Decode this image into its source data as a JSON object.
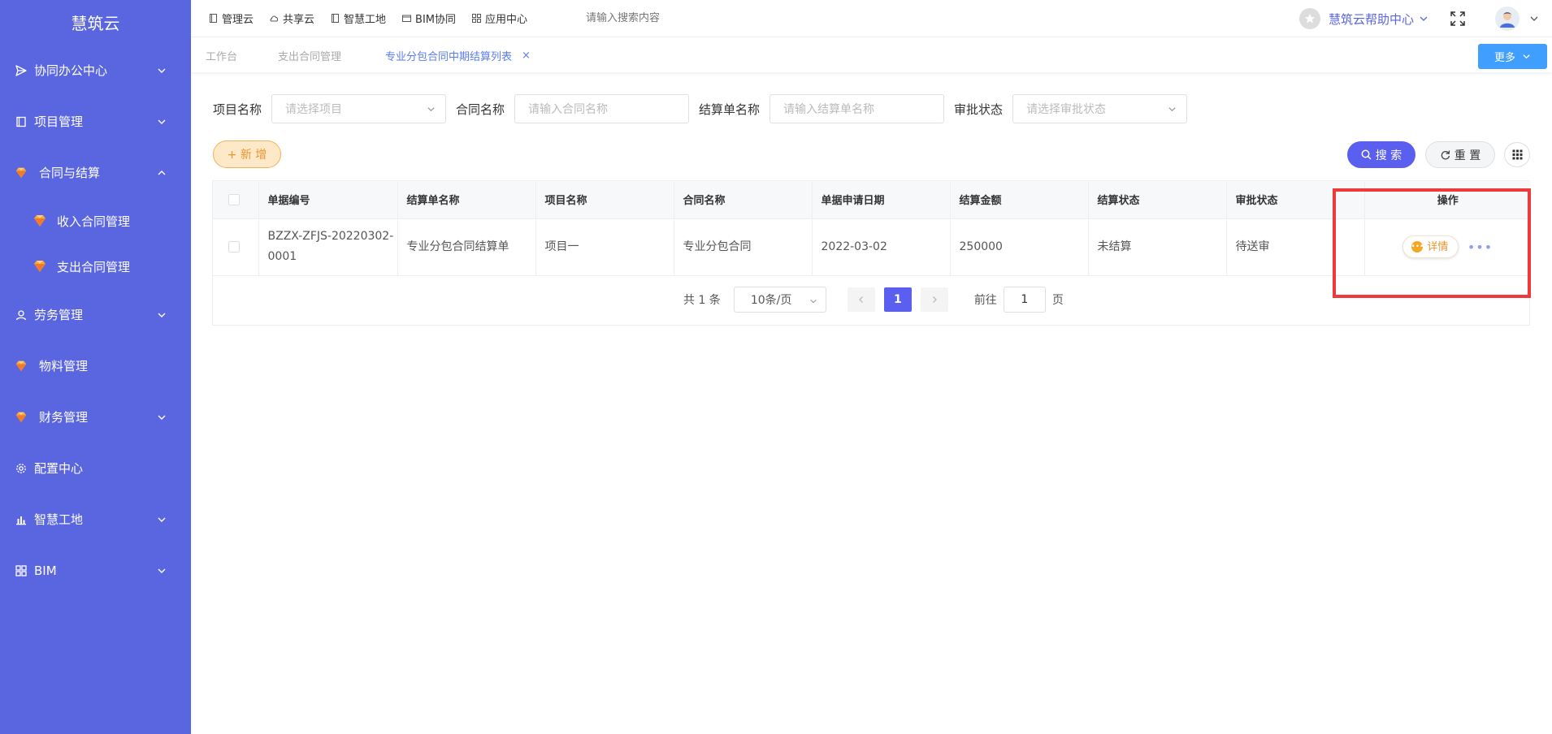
{
  "sidebar": {
    "brand": "慧筑云",
    "items": [
      {
        "label": "协同办公中心",
        "icon": "send-icon"
      },
      {
        "label": "项目管理",
        "icon": "book-icon"
      },
      {
        "label": "合同与结算",
        "icon": "gem-icon"
      },
      {
        "label": "收入合同管理",
        "icon": "gem-icon"
      },
      {
        "label": "支出合同管理",
        "icon": "gem-icon"
      },
      {
        "label": "劳务管理",
        "icon": "user-icon"
      },
      {
        "label": "物料管理",
        "icon": "gem-icon"
      },
      {
        "label": "财务管理",
        "icon": "gem-icon"
      },
      {
        "label": "配置中心",
        "icon": "gear-icon"
      },
      {
        "label": "智慧工地",
        "icon": "bar-chart-icon"
      },
      {
        "label": "BIM",
        "icon": "grid-icon"
      }
    ]
  },
  "topbar": {
    "links": [
      "管理云",
      "共享云",
      "智慧工地",
      "BIM协同",
      "应用中心"
    ],
    "search_placeholder": "请输入搜索内容",
    "help": "慧筑云帮助中心"
  },
  "tabs": {
    "items": [
      "工作台",
      "支出合同管理",
      "专业分包合同中期结算列表"
    ],
    "close": "×",
    "more": "更多"
  },
  "filters": {
    "project_label": "项目名称",
    "project_placeholder": "请选择项目",
    "contract_label": "合同名称",
    "contract_placeholder": "请输入合同名称",
    "settlement_label": "结算单名称",
    "settlement_placeholder": "请输入结算单名称",
    "approval_label": "审批状态",
    "approval_placeholder": "请选择审批状态"
  },
  "actions": {
    "add": "+ 新 增",
    "search": "搜 索",
    "reset": "重 置"
  },
  "table": {
    "headers": [
      "单据编号",
      "结算单名称",
      "项目名称",
      "合同名称",
      "单据申请日期",
      "结算金额",
      "结算状态",
      "审批状态",
      "操作"
    ],
    "rows": [
      {
        "code_line1": "BZZX-ZFJS-20220302-",
        "code_line2": "0001",
        "settlement_name": "专业分包合同结算单",
        "project": "项目一",
        "contract": "专业分包合同",
        "date": "2022-03-02",
        "amount": "250000",
        "settle_status": "未结算",
        "approval_status": "待送审",
        "detail": "详情",
        "more": "•••"
      }
    ]
  },
  "pagination": {
    "total": "共 1 条",
    "page_size": "10条/页",
    "current": "1",
    "goto_label": "前往",
    "goto_value": "1",
    "page_suffix": "页"
  },
  "colors": {
    "sidebar": "#5a65e0",
    "primary": "#5a5ff0",
    "accent_orange": "#e6962f",
    "highlight": "#ee3a3a"
  }
}
